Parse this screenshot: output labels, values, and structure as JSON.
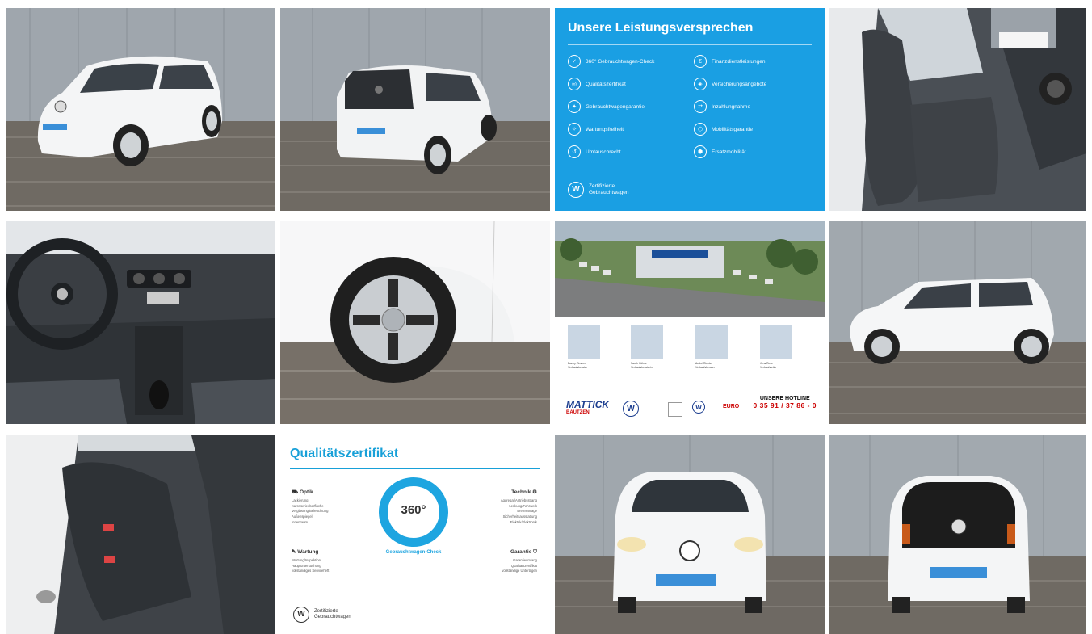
{
  "gallery": {
    "promo": {
      "title": "Unsere Leistungsversprechen",
      "items_left": [
        "360° Gebrauchtwagen-Check",
        "Qualitätszertifikat",
        "Gebrauchtwagengarantie",
        "Wartungsfreiheit",
        "Umtauschrecht"
      ],
      "items_right": [
        "Finanzdienstleistungen",
        "Versicherungsangebote",
        "Inzahlungnahme",
        "Mobilitätsgarantie",
        "Ersatzmobilität"
      ],
      "footer_line1": "Zertifizierte",
      "footer_line2": "Gebrauchtwagen",
      "background": "#1a9fe3"
    },
    "certificate": {
      "title": "Qualitätszertifikat",
      "ring_value": "360°",
      "ring_caption": "Gebrauchtwagen-Check",
      "optik_title": "Optik",
      "optik_items": [
        "Lackierung",
        "Karosserieoberfläche",
        "Verglasung/Beleuchtung",
        "Außenspiegel",
        "Innenraum"
      ],
      "technik_title": "Technik",
      "technik_items": [
        "Aggregat/Antriebsstrang",
        "Lenkung/Fahrwerk",
        "Bremsanlage",
        "Sicherheitsausstattung",
        "Elektrik/Elektronik"
      ],
      "wartung_title": "Wartung",
      "wartung_items": [
        "Wartung/Inspektion",
        "Hauptuntersuchung",
        "vollständiges Serviceheft"
      ],
      "garantie_title": "Garantie",
      "garantie_items": [
        "Garantieumfang",
        "Qualitätszertifikat",
        "vollständige Unterlagen"
      ],
      "footer_line1": "Zertifizierte",
      "footer_line2": "Gebrauchtwagen",
      "accent": "#17a0d8"
    },
    "dealer": {
      "staff": [
        {
          "name": "Danny Zimmer",
          "role": "Verkaufsberater"
        },
        {
          "name": "Sarah Kühne",
          "role": "Verkaufsberaterin"
        },
        {
          "name": "André Richter",
          "role": "Verkaufsberater"
        },
        {
          "name": "Jens Rose",
          "role": "Verkaufsleiter"
        }
      ],
      "brand": "MATTICK",
      "brand_city": "BAUTZEN",
      "hotline_label": "UNSERE HOTLINE",
      "hotline_number": "0 35 91 / 37 86 - 0"
    }
  }
}
